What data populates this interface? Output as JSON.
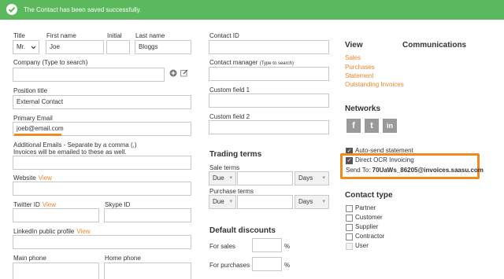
{
  "banner": {
    "message": "The Contact has been saved successfully."
  },
  "left": {
    "title_label": "Title",
    "title_value": "Mr.",
    "first_name_label": "First name",
    "first_name_value": "Joe",
    "initial_label": "Initial",
    "initial_value": "",
    "last_name_label": "Last name",
    "last_name_value": "Bloggs",
    "company_label": "Company (Type to search)",
    "company_value": "",
    "position_label": "Position title",
    "position_value": "External Contact",
    "primary_email_label": "Primary Email",
    "primary_email_value": "joeb@email.com",
    "additional_emails_label": "Additional Emails - Separate by a comma (,)",
    "additional_emails_note": "Invoices will be emailed to these as well.",
    "additional_emails_value": "",
    "website_label": "Website",
    "view_link": "View",
    "website_value": "",
    "twitter_label": "Twitter ID",
    "twitter_value": "",
    "skype_label": "Skype ID",
    "skype_value": "",
    "linkedin_label": "LinkedIn public profile",
    "linkedin_value": "",
    "main_phone_label": "Main phone",
    "home_phone_label": "Home phone"
  },
  "middle": {
    "contact_id_label": "Contact ID",
    "contact_id_value": "",
    "contact_manager_label": "Contact manager",
    "contact_manager_hint": "(Type to search)",
    "contact_manager_value": "",
    "custom1_label": "Custom field 1",
    "custom1_value": "",
    "custom2_label": "Custom field 2",
    "custom2_value": "",
    "trading_terms_heading": "Trading terms",
    "sale_terms_label": "Sale terms",
    "sale_terms_type": "Due",
    "sale_terms_value": "",
    "sale_terms_unit": "Days",
    "purchase_terms_label": "Purchase terms",
    "purchase_terms_type": "Due",
    "purchase_terms_value": "",
    "purchase_terms_unit": "Days",
    "default_discounts_heading": "Default discounts",
    "for_sales_label": "For sales",
    "for_sales_value": "",
    "percent": "%",
    "for_purchases_label": "For purchases",
    "for_purchases_value": ""
  },
  "right": {
    "view_heading": "View",
    "communications_heading": "Communications",
    "view_links": [
      "Sales",
      "Purchases",
      "Statement",
      "Outstanding Invoices"
    ],
    "networks_heading": "Networks",
    "social": [
      "f",
      "t",
      "in"
    ],
    "auto_send_label": "Auto-send statement",
    "direct_ocr_label": "Direct OCR Invoicing",
    "send_to_label": "Send To:",
    "send_to_value": "70UaWs_86205@invoices.saasu.com",
    "contact_type_heading": "Contact type",
    "contact_types": [
      "Partner",
      "Customer",
      "Supplier",
      "Contractor",
      "User"
    ]
  },
  "colors": {
    "accent": "#e8872b",
    "banner": "#5cb85c",
    "highlight": "#f08a1c"
  }
}
